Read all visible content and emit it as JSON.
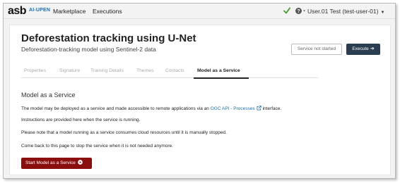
{
  "brand": {
    "logo_text": "asb",
    "sublogo_text": "AI-UPEN"
  },
  "nav": {
    "marketplace": "Marketplace",
    "executions": "Executions"
  },
  "user": {
    "name": "User.01 Test (test-user-01)"
  },
  "model": {
    "title": "Deforestation tracking using U-Net",
    "subtitle": "Deforestation-tracking model using Sentinel-2 data",
    "status_label": "Service not started",
    "execute_label": "Execute"
  },
  "tabs": [
    {
      "label": "Properties"
    },
    {
      "label": "Signature"
    },
    {
      "label": "Training Details"
    },
    {
      "label": "Themes"
    },
    {
      "label": "Contacts"
    },
    {
      "label": "Model as a Service"
    }
  ],
  "content": {
    "section_title": "Model as a Service",
    "p1_before": "The model may be deployed as a service and made accessible to remote applications via an",
    "p1_link": "OGC API - Processes",
    "p1_after": "interface.",
    "p2": "Instructions are provided here when the service is running.",
    "p3": "Please note that a model running as a service consumes cloud resources until it is manually stopped.",
    "p4": "Come back to this page to stop the service when it is not needed anymore.",
    "start_label": "Start Model as a Service"
  },
  "colors": {
    "primary_dark": "#2b3e50",
    "danger": "#8b0e0e",
    "link": "#1b6fb5",
    "ok": "#4a9a2a"
  }
}
